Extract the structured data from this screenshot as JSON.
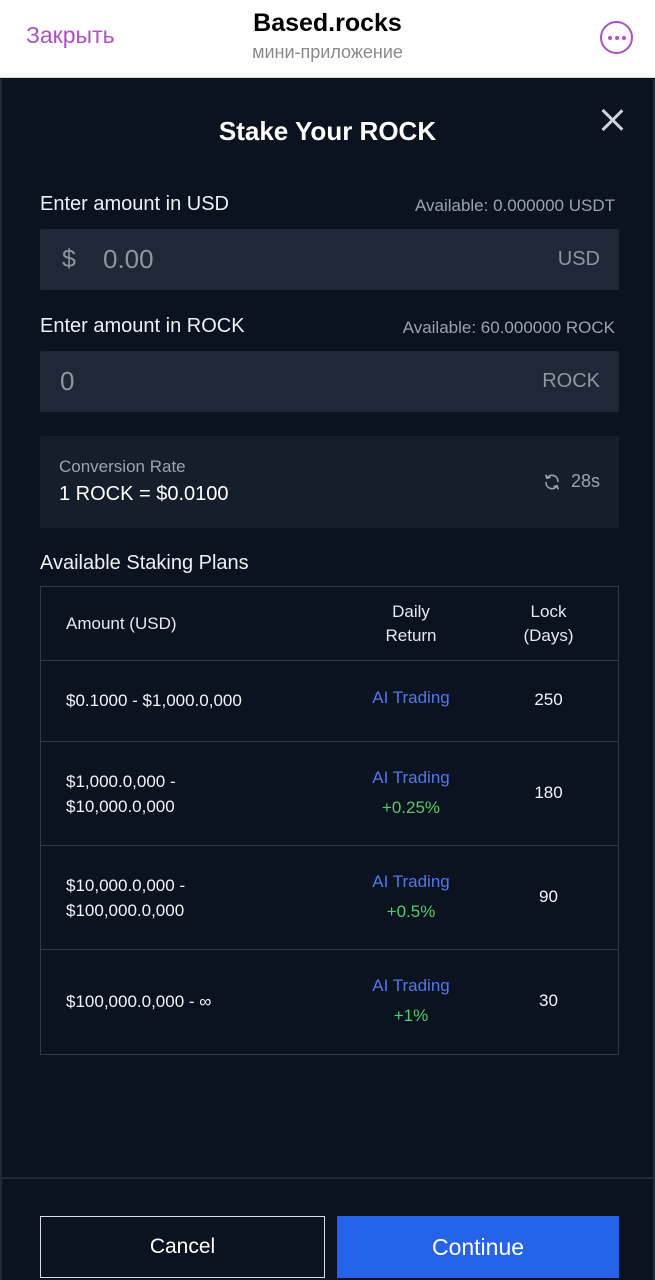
{
  "tg_header": {
    "close_label": "Закрыть",
    "title": "Based.rocks",
    "subtitle": "мини-приложение",
    "more_icon": "ellipsis-circle-icon"
  },
  "modal": {
    "title": "Stake Your ROCK",
    "close_icon": "close-icon"
  },
  "usd_input": {
    "label": "Enter amount in USD",
    "available": "Available: 0.000000 USDT",
    "prefix": "$",
    "placeholder": "0.00",
    "suffix": "USD"
  },
  "rock_input": {
    "label": "Enter amount in ROCK",
    "available": "Available: 60.000000 ROCK",
    "placeholder": "0",
    "suffix": "ROCK"
  },
  "conversion": {
    "label": "Conversion Rate",
    "value": "1 ROCK = $0.0100",
    "timer": "28s",
    "icon": "refresh-icon"
  },
  "plans": {
    "title": "Available Staking Plans",
    "headers": {
      "amount": "Amount (USD)",
      "daily_line1": "Daily",
      "daily_line2": "Return",
      "lock_line1": "Lock",
      "lock_line2": "(Days)"
    },
    "rows": [
      {
        "amount_line1": "$0.1000 - $1,000.0,000",
        "amount_line2": "",
        "daily_name": "AI Trading",
        "daily_bonus": "",
        "lock": "250"
      },
      {
        "amount_line1": "$1,000.0,000 -",
        "amount_line2": "$10,000.0,000",
        "daily_name": "AI Trading",
        "daily_bonus": "+0.25%",
        "lock": "180"
      },
      {
        "amount_line1": "$10,000.0,000 -",
        "amount_line2": "$100,000.0,000",
        "daily_name": "AI Trading",
        "daily_bonus": "+0.5%",
        "lock": "90"
      },
      {
        "amount_line1": "$100,000.0,000 - ∞",
        "amount_line2": "",
        "daily_name": "AI Trading",
        "daily_bonus": "+1%",
        "lock": "30"
      }
    ]
  },
  "actions": {
    "cancel_label": "Cancel",
    "continue_label": "Continue"
  },
  "colors": {
    "background": "#0b1220",
    "accent_blue": "#2563eb",
    "plan_name": "#4f78f0",
    "bonus_green": "#4fcf6b",
    "telegram_purple": "#b04fc8"
  }
}
